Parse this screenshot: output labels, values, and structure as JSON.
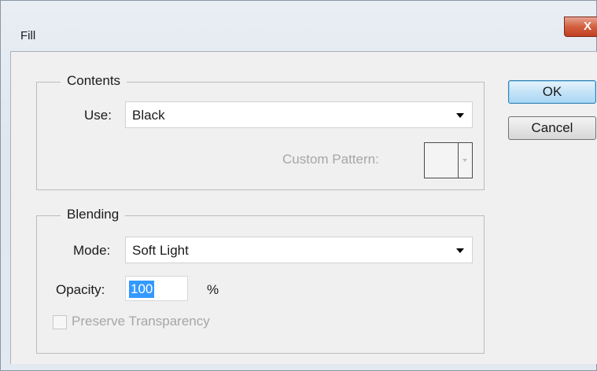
{
  "window": {
    "title": "Fill",
    "close_glyph": "X"
  },
  "contents": {
    "legend": "Contents",
    "use_label": "Use:",
    "use_value": "Black",
    "custom_pattern_label": "Custom Pattern:"
  },
  "blending": {
    "legend": "Blending",
    "mode_label": "Mode:",
    "mode_value": "Soft Light",
    "opacity_label": "Opacity:",
    "opacity_value": "100",
    "opacity_unit": "%",
    "preserve_label": "Preserve Transparency",
    "preserve_checked": false
  },
  "buttons": {
    "ok": "OK",
    "cancel": "Cancel"
  }
}
